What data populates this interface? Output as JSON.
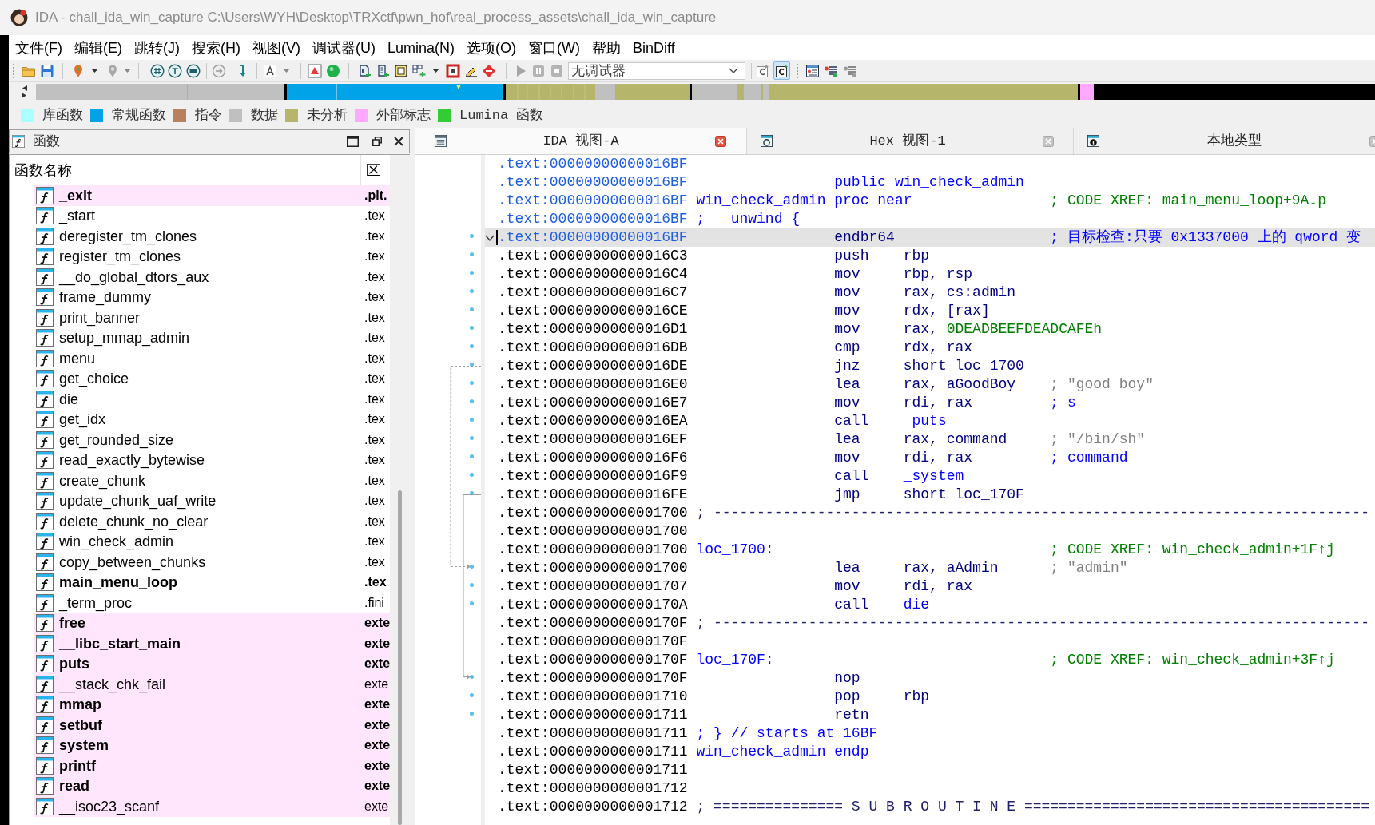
{
  "window": {
    "title": "IDA - chall_ida_win_capture C:\\Users\\WYH\\Desktop\\TRXctf\\pwn_hof\\real_process_assets\\chall_ida_win_capture"
  },
  "menu": [
    "文件(F)",
    "编辑(E)",
    "跳转(J)",
    "搜索(H)",
    "视图(V)",
    "调试器(U)",
    "Lumina(N)",
    "选项(O)",
    "窗口(W)",
    "帮助",
    "BinDiff"
  ],
  "toolbar": {
    "debugger": "无调试器",
    "toggles": [
      {
        "on": false
      },
      {
        "on": true
      }
    ]
  },
  "legend": [
    {
      "label": "库函数",
      "color": "#aaffff"
    },
    {
      "label": "常规函数",
      "color": "#00a2e8"
    },
    {
      "label": "指令",
      "color": "#b8805c"
    },
    {
      "label": "数据",
      "color": "#c0c0c0"
    },
    {
      "label": "未分析",
      "color": "#b5b56c"
    },
    {
      "label": "外部标志",
      "color": "#ffa8ff"
    },
    {
      "label": "Lumina 函数",
      "color": "#33cc33"
    }
  ],
  "functions_panel": {
    "title": "函数",
    "columns": [
      "函数名称",
      "区"
    ],
    "rows": [
      {
        "name": "_exit",
        "segment": ".plt.",
        "kind": "import",
        "bold": true
      },
      {
        "name": "_start",
        "segment": ".tex",
        "kind": "regular",
        "bold": false
      },
      {
        "name": "deregister_tm_clones",
        "segment": ".tex",
        "kind": "regular",
        "bold": false
      },
      {
        "name": "register_tm_clones",
        "segment": ".tex",
        "kind": "regular",
        "bold": false
      },
      {
        "name": "__do_global_dtors_aux",
        "segment": ".tex",
        "kind": "regular",
        "bold": false
      },
      {
        "name": "frame_dummy",
        "segment": ".tex",
        "kind": "regular",
        "bold": false
      },
      {
        "name": "print_banner",
        "segment": ".tex",
        "kind": "regular",
        "bold": false
      },
      {
        "name": "setup_mmap_admin",
        "segment": ".tex",
        "kind": "regular",
        "bold": false
      },
      {
        "name": "menu",
        "segment": ".tex",
        "kind": "regular",
        "bold": false
      },
      {
        "name": "get_choice",
        "segment": ".tex",
        "kind": "regular",
        "bold": false
      },
      {
        "name": "die",
        "segment": ".tex",
        "kind": "regular",
        "bold": false
      },
      {
        "name": "get_idx",
        "segment": ".tex",
        "kind": "regular",
        "bold": false
      },
      {
        "name": "get_rounded_size",
        "segment": ".tex",
        "kind": "regular",
        "bold": false
      },
      {
        "name": "read_exactly_bytewise",
        "segment": ".tex",
        "kind": "regular",
        "bold": false
      },
      {
        "name": "create_chunk",
        "segment": ".tex",
        "kind": "regular",
        "bold": false
      },
      {
        "name": "update_chunk_uaf_write",
        "segment": ".tex",
        "kind": "regular",
        "bold": false
      },
      {
        "name": "delete_chunk_no_clear",
        "segment": ".tex",
        "kind": "regular",
        "bold": false
      },
      {
        "name": "win_check_admin",
        "segment": ".tex",
        "kind": "regular",
        "bold": false
      },
      {
        "name": "copy_between_chunks",
        "segment": ".tex",
        "kind": "regular",
        "bold": false
      },
      {
        "name": "main_menu_loop",
        "segment": ".tex",
        "kind": "regular",
        "bold": true
      },
      {
        "name": "_term_proc",
        "segment": ".fini",
        "kind": "regular",
        "bold": false
      },
      {
        "name": "free",
        "segment": "exte",
        "kind": "import",
        "bold": true
      },
      {
        "name": "__libc_start_main",
        "segment": "exte",
        "kind": "import",
        "bold": true
      },
      {
        "name": "puts",
        "segment": "exte",
        "kind": "import",
        "bold": true
      },
      {
        "name": "__stack_chk_fail",
        "segment": "exte",
        "kind": "import",
        "bold": false
      },
      {
        "name": "mmap",
        "segment": "exte",
        "kind": "import",
        "bold": true
      },
      {
        "name": "setbuf",
        "segment": "exte",
        "kind": "import",
        "bold": true
      },
      {
        "name": "system",
        "segment": "exte",
        "kind": "import",
        "bold": true
      },
      {
        "name": "printf",
        "segment": "exte",
        "kind": "import",
        "bold": true
      },
      {
        "name": "read",
        "segment": "exte",
        "kind": "import",
        "bold": true
      },
      {
        "name": "__isoc23_scanf",
        "segment": "exte",
        "kind": "import",
        "bold": false
      }
    ]
  },
  "tabs": [
    {
      "label": "IDA 视图-A",
      "selected": true
    },
    {
      "label": "Hex 视图-1",
      "selected": false
    },
    {
      "label": "本地类型",
      "selected": false
    }
  ],
  "disassembly": {
    "lines": [
      {
        "address": ".text:00000000000016BF",
        "address_highlighted": true,
        "kind": "plain",
        "selected": false
      },
      {
        "address": ".text:00000000000016BF",
        "address_highlighted": true,
        "kind": "directive",
        "selected": false,
        "mnemonic": "public win_check_admin"
      },
      {
        "address": ".text:00000000000016BF",
        "address_highlighted": true,
        "kind": "directive",
        "selected": false,
        "label": {
          "text": "win_check_admin",
          "kind": "name"
        },
        "mnemonic": "proc near",
        "comment": {
          "text": "; CODE XREF: main_menu_loop+9A↓p",
          "kind": "xref"
        }
      },
      {
        "address": ".text:00000000000016BF",
        "address_highlighted": true,
        "kind": "plain",
        "selected": false,
        "label": {
          "text": "; __unwind {",
          "kind": "name"
        }
      },
      {
        "address": ".text:00000000000016BF",
        "address_highlighted": true,
        "kind": "instruction",
        "selected": true,
        "expanded": true,
        "mnemonic": "endbr64",
        "comment": {
          "text": "; 目标检查:只要 0x1337000 上的 qword 变",
          "kind": "note"
        }
      },
      {
        "address": ".text:00000000000016C3",
        "address_highlighted": false,
        "kind": "instruction",
        "selected": false,
        "mnemonic": "push",
        "operands": [
          {
            "text": "rbp",
            "kind": "plain"
          }
        ]
      },
      {
        "address": ".text:00000000000016C4",
        "address_highlighted": false,
        "kind": "instruction",
        "selected": false,
        "mnemonic": "mov",
        "operands": [
          {
            "text": "rbp, rsp",
            "kind": "plain"
          }
        ]
      },
      {
        "address": ".text:00000000000016C7",
        "address_highlighted": false,
        "kind": "instruction",
        "selected": false,
        "mnemonic": "mov",
        "operands": [
          {
            "text": "rax, cs:admin",
            "kind": "plain"
          }
        ]
      },
      {
        "address": ".text:00000000000016CE",
        "address_highlighted": false,
        "kind": "instruction",
        "selected": false,
        "mnemonic": "mov",
        "operands": [
          {
            "text": "rdx, [rax]",
            "kind": "plain"
          }
        ]
      },
      {
        "address": ".text:00000000000016D1",
        "address_highlighted": false,
        "kind": "instruction",
        "selected": false,
        "mnemonic": "mov",
        "operands": [
          {
            "text": "rax,",
            "kind": "plain"
          },
          {
            "text": "0DEADBEEFDEADCAFEh",
            "kind": "number"
          }
        ]
      },
      {
        "address": ".text:00000000000016DB",
        "address_highlighted": false,
        "kind": "instruction",
        "selected": false,
        "mnemonic": "cmp",
        "operands": [
          {
            "text": "rdx, rax",
            "kind": "plain"
          }
        ]
      },
      {
        "address": ".text:00000000000016DE",
        "address_highlighted": false,
        "kind": "instruction",
        "selected": false,
        "mnemonic": "jnz",
        "operands": [
          {
            "text": "short loc_1700",
            "kind": "plain"
          }
        ],
        "jump_source": true,
        "conditional": true
      },
      {
        "address": ".text:00000000000016E0",
        "address_highlighted": false,
        "kind": "instruction",
        "selected": false,
        "mnemonic": "lea",
        "operands": [
          {
            "text": "rax, aGoodBoy",
            "kind": "plain"
          }
        ],
        "comment": {
          "text": "; \"good boy\"",
          "kind": "string"
        }
      },
      {
        "address": ".text:00000000000016E7",
        "address_highlighted": false,
        "kind": "instruction",
        "selected": false,
        "mnemonic": "mov",
        "operands": [
          {
            "text": "rdi, rax",
            "kind": "plain"
          }
        ],
        "comment": {
          "text": "; s",
          "kind": "note"
        }
      },
      {
        "address": ".text:00000000000016EA",
        "address_highlighted": false,
        "kind": "instruction",
        "selected": false,
        "mnemonic": "call",
        "operands": [
          {
            "text": "_puts",
            "kind": "name"
          }
        ]
      },
      {
        "address": ".text:00000000000016EF",
        "address_highlighted": false,
        "kind": "instruction",
        "selected": false,
        "mnemonic": "lea",
        "operands": [
          {
            "text": "rax, command",
            "kind": "plain"
          }
        ],
        "comment": {
          "text": "; \"/bin/sh\"",
          "kind": "string"
        }
      },
      {
        "address": ".text:00000000000016F6",
        "address_highlighted": false,
        "kind": "instruction",
        "selected": false,
        "mnemonic": "mov",
        "operands": [
          {
            "text": "rdi, rax",
            "kind": "plain"
          }
        ],
        "comment": {
          "text": "; command",
          "kind": "note"
        }
      },
      {
        "address": ".text:00000000000016F9",
        "address_highlighted": false,
        "kind": "instruction",
        "selected": false,
        "mnemonic": "call",
        "operands": [
          {
            "text": "_system",
            "kind": "name"
          }
        ]
      },
      {
        "address": ".text:00000000000016FE",
        "address_highlighted": false,
        "kind": "instruction",
        "selected": false,
        "mnemonic": "jmp",
        "operands": [
          {
            "text": "short loc_170F",
            "kind": "plain"
          }
        ],
        "jump_source": true,
        "conditional": false
      },
      {
        "address": ".text:0000000000001700",
        "address_highlighted": false,
        "kind": "plain",
        "selected": false,
        "label": {
          "text": "; ----------------------------------------------------------------------------",
          "kind": "separator"
        }
      },
      {
        "address": ".text:0000000000001700",
        "address_highlighted": false,
        "kind": "plain",
        "selected": false
      },
      {
        "address": ".text:0000000000001700",
        "address_highlighted": false,
        "kind": "plain",
        "selected": false,
        "label": {
          "text": "loc_1700:",
          "kind": "name"
        },
        "comment": {
          "text": "; CODE XREF: win_check_admin+1F↑j",
          "kind": "xref"
        }
      },
      {
        "address": ".text:0000000000001700",
        "address_highlighted": false,
        "kind": "instruction",
        "selected": false,
        "mnemonic": "lea",
        "operands": [
          {
            "text": "rax, aAdmin",
            "kind": "plain"
          }
        ],
        "comment": {
          "text": "; \"admin\"",
          "kind": "string"
        },
        "jump_target": true,
        "conditional": true
      },
      {
        "address": ".text:0000000000001707",
        "address_highlighted": false,
        "kind": "instruction",
        "selected": false,
        "mnemonic": "mov",
        "operands": [
          {
            "text": "rdi, rax",
            "kind": "plain"
          }
        ]
      },
      {
        "address": ".text:000000000000170A",
        "address_highlighted": false,
        "kind": "instruction",
        "selected": false,
        "mnemonic": "call",
        "operands": [
          {
            "text": "die",
            "kind": "name"
          }
        ]
      },
      {
        "address": ".text:000000000000170F",
        "address_highlighted": false,
        "kind": "plain",
        "selected": false,
        "label": {
          "text": "; ----------------------------------------------------------------------------",
          "kind": "separator"
        }
      },
      {
        "address": ".text:000000000000170F",
        "address_highlighted": false,
        "kind": "plain",
        "selected": false
      },
      {
        "address": ".text:000000000000170F",
        "address_highlighted": false,
        "kind": "plain",
        "selected": false,
        "label": {
          "text": "loc_170F:",
          "kind": "name"
        },
        "comment": {
          "text": "; CODE XREF: win_check_admin+3F↑j",
          "kind": "xref"
        }
      },
      {
        "address": ".text:000000000000170F",
        "address_highlighted": false,
        "kind": "instruction",
        "selected": false,
        "mnemonic": "nop",
        "jump_target": true,
        "conditional": false
      },
      {
        "address": ".text:0000000000001710",
        "address_highlighted": false,
        "kind": "instruction",
        "selected": false,
        "mnemonic": "pop",
        "operands": [
          {
            "text": "rbp",
            "kind": "plain"
          }
        ]
      },
      {
        "address": ".text:0000000000001711",
        "address_highlighted": false,
        "kind": "instruction",
        "selected": false,
        "mnemonic": "retn"
      },
      {
        "address": ".text:0000000000001711",
        "address_highlighted": false,
        "kind": "plain",
        "selected": false,
        "label": {
          "text": "; } // starts at 16BF",
          "kind": "name"
        }
      },
      {
        "address": ".text:0000000000001711",
        "address_highlighted": false,
        "kind": "directive",
        "selected": false,
        "label": {
          "text": "win_check_admin",
          "kind": "name"
        },
        "mnemonic": "endp"
      },
      {
        "address": ".text:0000000000001711",
        "address_highlighted": false,
        "kind": "plain",
        "selected": false
      },
      {
        "address": ".text:0000000000001712",
        "address_highlighted": false,
        "kind": "plain",
        "selected": false
      },
      {
        "address": ".text:0000000000001712",
        "address_highlighted": false,
        "kind": "plain",
        "selected": false,
        "label": {
          "text": "; =============== S U B R O U T I N E ========================================",
          "kind": "separator"
        }
      }
    ]
  }
}
